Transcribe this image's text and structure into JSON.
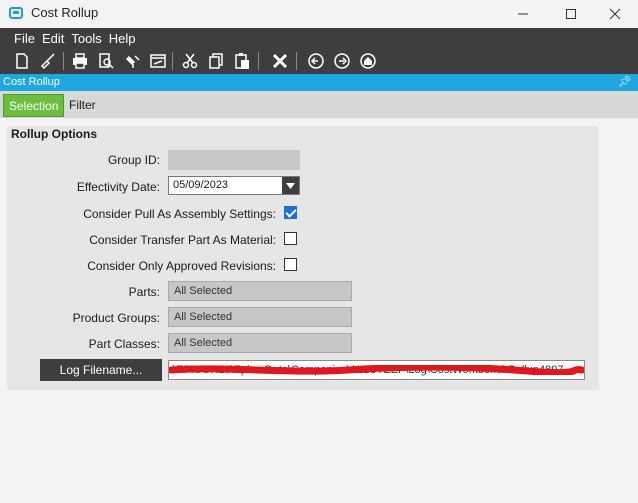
{
  "window": {
    "title": "Cost Rollup"
  },
  "menu": [
    "File",
    "Edit",
    "Tools",
    "Help"
  ],
  "panel": {
    "title": "Cost Rollup"
  },
  "tabs": [
    {
      "label": "Selection"
    },
    {
      "label": "Filter"
    }
  ],
  "rollup": {
    "title": "Rollup Options",
    "group_id_label": "Group ID:",
    "effectivity_label": "Effectivity Date:",
    "effectivity_value": "05/09/2023",
    "consider_pull_label": "Consider Pull As Assembly Settings:",
    "consider_pull_checked": true,
    "consider_transfer_label": "Consider Transfer Part As Material:",
    "consider_transfer_checked": false,
    "consider_approved_label": "Consider Only Approved Revisions:",
    "consider_approved_checked": false,
    "parts_label": "Parts:",
    "parts_value": "All Selected",
    "product_groups_label": "Product Groups:",
    "product_groups_value": "All Selected",
    "part_classes_label": "Part Classes:",
    "part_classes_value": "All Selected",
    "log_button_label": "Log Filename...",
    "log_path_value": "\\EPICOR10\\EpicorData\\Companies\\ALLSTEEP\\Log\\CostWorkbenchRollup4897"
  },
  "colors": {
    "accent": "#1ea7e1",
    "tab_active": "#6cbf3e",
    "toolbar": "#3e3e3e",
    "redaction": "#e0181e"
  }
}
